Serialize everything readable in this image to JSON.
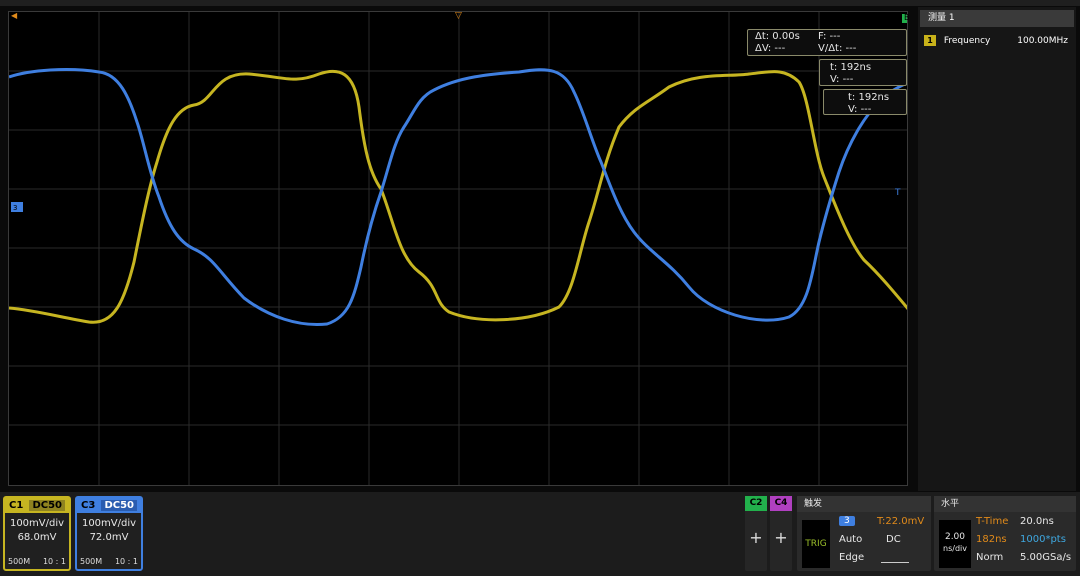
{
  "cursor_readout": {
    "delta_t": "Δt: 0.00s",
    "freq": "F: ---",
    "delta_v": "ΔV: ---",
    "dv_dt": "V/Δt: ---",
    "cursor_a_t": "t: 192ns",
    "cursor_a_v": "V: ---",
    "cursor_b_t": "t: 192ns",
    "cursor_b_v": "V: ---"
  },
  "markers": {
    "right_top": "B",
    "right_mid": "T"
  },
  "measurement": {
    "title": "测量 1",
    "index": "1",
    "name": "Frequency",
    "value": "100.00MHz"
  },
  "channels": [
    {
      "label": "C1",
      "coupling": "DC50",
      "scale": "100mV/div",
      "offset": "68.0mV",
      "bandwidth": "500M",
      "probe": "10 : 1",
      "color": "#c6b521"
    },
    {
      "label": "C3",
      "coupling": "DC50",
      "scale": "100mV/div",
      "offset": "72.0mV",
      "bandwidth": "500M",
      "probe": "10 : 1",
      "color": "#3f7fe0"
    }
  ],
  "add_channels": [
    {
      "label": "C2",
      "plus": "+",
      "color": "#22b14c"
    },
    {
      "label": "C4",
      "plus": "+",
      "color": "#b040c0"
    }
  ],
  "trigger": {
    "title": "触发",
    "box": "TRIG",
    "source": "3",
    "level": "T:22.0mV",
    "mode": "Auto",
    "coupling": "DC",
    "type": "Edge"
  },
  "horizontal": {
    "title": "水平",
    "scale_num": "2.00",
    "scale_unit": "ns/div",
    "ttime_label": "T-Time",
    "ttime": "20.0ns",
    "delay": "182ns",
    "points": "1000*pts",
    "acq_mode": "Norm",
    "sample_rate": "5.00GSa/s"
  },
  "colors": {
    "ch1_trace": "#c6b521",
    "ch3_trace": "#3f7fe0",
    "orange_marker": "#e08a1a"
  }
}
